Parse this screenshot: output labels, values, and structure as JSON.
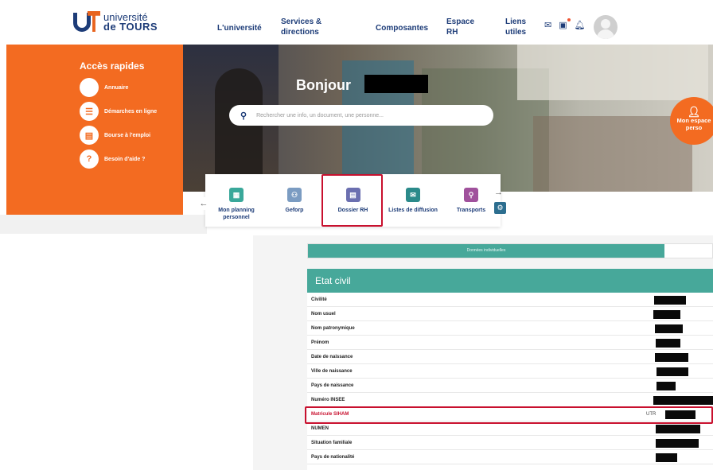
{
  "header": {
    "logo_line1": "université",
    "logo_line2": "de TOURS",
    "nav": [
      {
        "label": "L'université"
      },
      {
        "label": "Services &\ndirections"
      },
      {
        "label": "Composantes"
      },
      {
        "label": "Espace\nRH"
      },
      {
        "label": "Liens\nutiles"
      }
    ],
    "icons": [
      "mail-icon",
      "calendar-icon",
      "bell-icon"
    ]
  },
  "quick_access": {
    "title": "Accès rapides",
    "items": [
      {
        "label": "Annuaire",
        "icon": "directory-icon"
      },
      {
        "label": "Démarches en ligne",
        "icon": "list-icon"
      },
      {
        "label": "Bourse à l'emploi",
        "icon": "briefcase-icon"
      },
      {
        "label": "Besoin d'aide ?",
        "icon": "help-icon"
      }
    ]
  },
  "hero": {
    "greeting": "Bonjour",
    "search_placeholder": "Rechercher une info, un document, une personne...",
    "espace_perso": "Mon espace\nperso"
  },
  "tiles": [
    {
      "label": "Mon planning\npersonnel",
      "color": "#3aa89a"
    },
    {
      "label": "Geforp",
      "color": "#7b9cc2"
    },
    {
      "label": "Dossier RH",
      "color": "#6b6fb0"
    },
    {
      "label": "Listes de diffusion",
      "color": "#2b8a8a"
    },
    {
      "label": "Transports",
      "color": "#a0519c"
    }
  ],
  "tabs": {
    "active_label": "Données individuelles"
  },
  "etat_civil": {
    "title": "Etat civil",
    "rows": [
      {
        "label": "Civilité"
      },
      {
        "label": "Nom usuel"
      },
      {
        "label": "Nom patronymique"
      },
      {
        "label": "Prénom"
      },
      {
        "label": "Date de naissance"
      },
      {
        "label": "Ville de naissance"
      },
      {
        "label": "Pays de naissance"
      },
      {
        "label": "Numéro INSEE"
      },
      {
        "label": "Matricule SIHAM",
        "value_prefix": "UTR"
      },
      {
        "label": "NUMEN"
      },
      {
        "label": "Situation familiale"
      },
      {
        "label": "Pays de nationalité"
      }
    ]
  },
  "colors": {
    "brand_orange": "#f36b21",
    "brand_blue": "#1d3c78",
    "teal": "#47a89a",
    "highlight_red": "#c8102e"
  }
}
